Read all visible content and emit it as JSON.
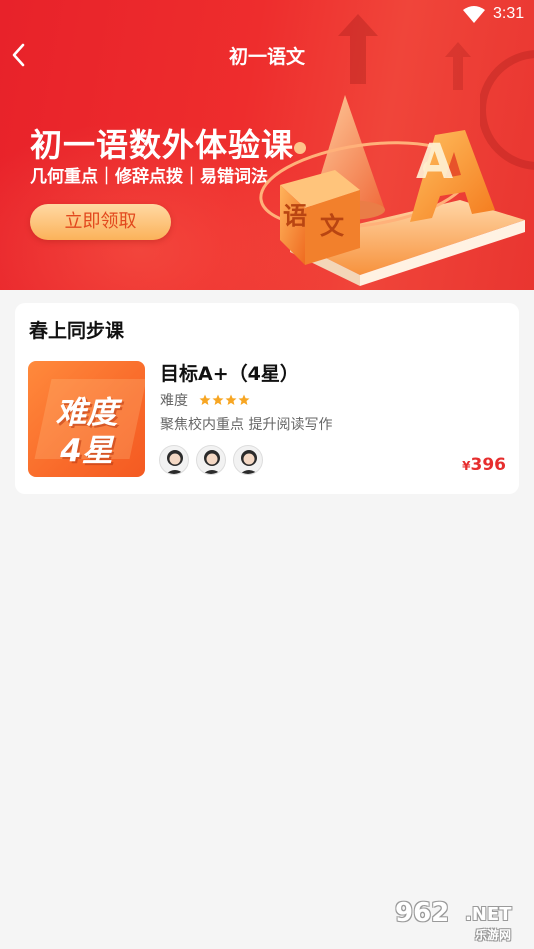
{
  "status_bar": {
    "time": "3:31",
    "wifi_icon": "wifi-icon"
  },
  "header": {
    "title": "初一语文",
    "back_icon": "back-arrow-icon"
  },
  "banner": {
    "title": "初一语数外体验课",
    "subtitle": "几何重点｜修辞点拨｜易错词法",
    "button_label": "立即领取",
    "art_characters": [
      "语",
      "文",
      "A"
    ]
  },
  "section": {
    "title": "春上同步课",
    "courses": [
      {
        "thumbnail_line1": "难度",
        "thumbnail_line2": "4星",
        "name": "目标A+（4星）",
        "difficulty_label": "难度",
        "difficulty_stars": 4,
        "description": "聚焦校内重点 提升阅读写作",
        "teacher_count": 3,
        "price_currency": "¥",
        "price_value": "396"
      }
    ]
  },
  "watermark": {
    "logo": "962",
    "net": ".NET",
    "sub": "乐游网"
  },
  "colors": {
    "brand_red": "#e8222a",
    "price_red": "#e62e2e",
    "button_gold": "#fbb25a",
    "star_orange": "#f7a623",
    "thumb_orange": "#f96a2a"
  }
}
